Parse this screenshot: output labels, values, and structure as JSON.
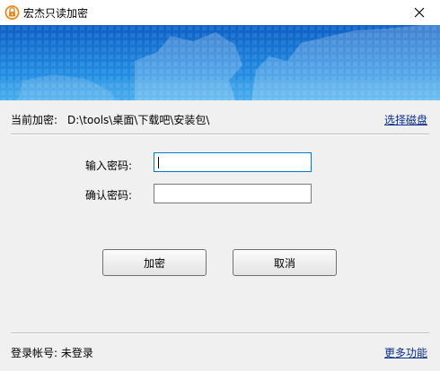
{
  "window": {
    "title": "宏杰只读加密"
  },
  "path": {
    "label": "当前加密:",
    "value": "D:\\tools\\桌面\\下载吧\\安装包\\",
    "select_disk": "选择磁盘"
  },
  "form": {
    "password_label": "输入密码:",
    "password_value": "",
    "confirm_label": "确认密码:",
    "confirm_value": ""
  },
  "buttons": {
    "encrypt": "加密",
    "cancel": "取消"
  },
  "footer": {
    "login_status": "登录帐号: 未登录",
    "more_features": "更多功能"
  },
  "colors": {
    "banner_top": "#0d5fc4",
    "banner_bottom": "#35a5ec",
    "link": "#0b2f8a",
    "focus_border": "#0078d7"
  }
}
